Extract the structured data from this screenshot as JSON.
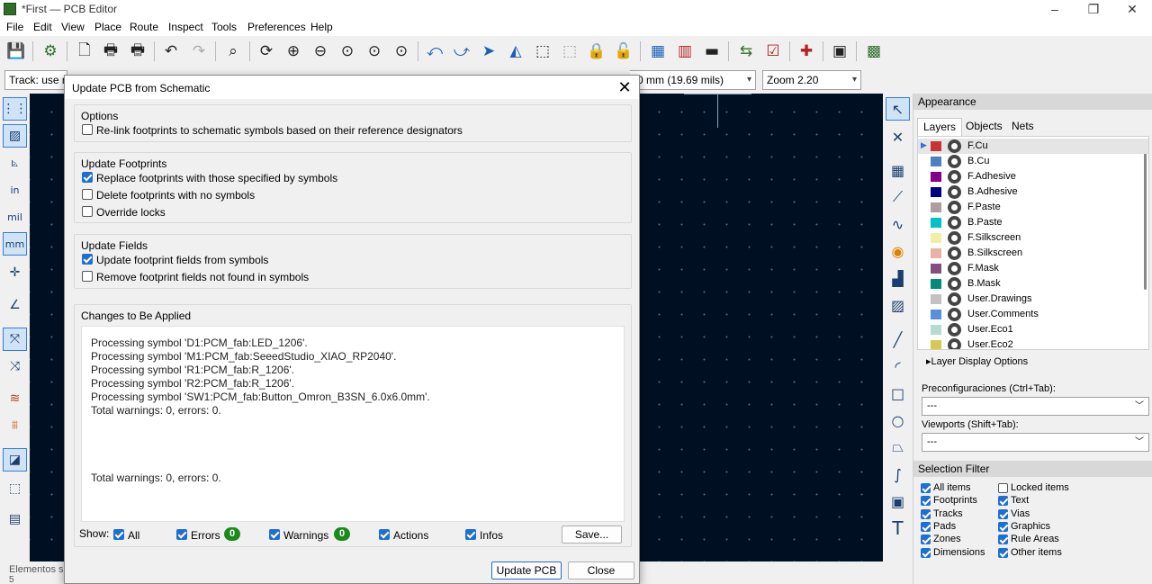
{
  "window": {
    "title": "*First — PCB Editor",
    "minimize": "–",
    "maximize": "❐",
    "close": "✕"
  },
  "menu": [
    "File",
    "Edit",
    "View",
    "Place",
    "Route",
    "Inspect",
    "Tools",
    "Preferences",
    "Help"
  ],
  "aux": {
    "track": "Track: use ne",
    "grid": "0 mm (19.69 mils)",
    "zoom": "Zoom 2.20"
  },
  "status": {
    "line1": "Elementos s",
    "line2": "5"
  },
  "appearance": {
    "header": "Appearance",
    "tabs": [
      "Layers",
      "Objects",
      "Nets"
    ],
    "layers": [
      {
        "name": "F.Cu",
        "color": "#c83434"
      },
      {
        "name": "B.Cu",
        "color": "#4d7fc4"
      },
      {
        "name": "F.Adhesive",
        "color": "#84008a"
      },
      {
        "name": "B.Adhesive",
        "color": "#000084"
      },
      {
        "name": "F.Paste",
        "color": "#b09d9d"
      },
      {
        "name": "B.Paste",
        "color": "#00c2c2"
      },
      {
        "name": "F.Silkscreen",
        "color": "#f2eda1"
      },
      {
        "name": "B.Silkscreen",
        "color": "#e8b2a7"
      },
      {
        "name": "F.Mask",
        "color": "#844c84"
      },
      {
        "name": "B.Mask",
        "color": "#028a7c"
      },
      {
        "name": "User.Drawings",
        "color": "#c2c2c2"
      },
      {
        "name": "User.Comments",
        "color": "#5990db"
      },
      {
        "name": "User.Eco1",
        "color": "#b4dbd2"
      },
      {
        "name": "User.Eco2",
        "color": "#d8c852"
      }
    ],
    "layer_display": "Layer Display Options",
    "presets_label": "Preconfiguraciones (Ctrl+Tab):",
    "presets_value": "---",
    "viewports_label": "Viewports (Shift+Tab):",
    "viewports_value": "---"
  },
  "selection_filter": {
    "header": "Selection Filter",
    "left": [
      "All items",
      "Footprints",
      "Tracks",
      "Pads",
      "Zones",
      "Dimensions"
    ],
    "right": [
      "Locked items",
      "Text",
      "Vias",
      "Graphics",
      "Rule Areas",
      "Other items"
    ],
    "locked_checked": false
  },
  "dialog": {
    "title": "Update PCB from Schematic",
    "close": "✕",
    "options_title": "Options",
    "relink": "Re-link footprints to schematic symbols based on their reference designators",
    "footprints_title": "Update Footprints",
    "replace": "Replace footprints with those specified by symbols",
    "delete": "Delete footprints with no symbols",
    "override": "Override locks",
    "fields_title": "Update Fields",
    "update_fields": "Update footprint fields from symbols",
    "remove_fields": "Remove footprint fields not found in symbols",
    "changes_title": "Changes to Be Applied",
    "log": [
      "Processing symbol 'D1:PCM_fab:LED_1206'.",
      "Processing symbol 'M1:PCM_fab:SeeedStudio_XIAO_RP2040'.",
      "Processing symbol 'R1:PCM_fab:R_1206'.",
      "Processing symbol 'R2:PCM_fab:R_1206'.",
      "Processing symbol 'SW1:PCM_fab:Button_Omron_B3SN_6.0x6.0mm'.",
      "Total warnings: 0, errors: 0."
    ],
    "log_total": "Total warnings: 0, errors: 0.",
    "show_label": "Show:",
    "filters": {
      "all": "All",
      "errors": "Errors",
      "warnings": "Warnings",
      "actions": "Actions",
      "infos": "Infos"
    },
    "errors_count": "0",
    "warnings_count": "0",
    "save": "Save...",
    "update": "Update PCB",
    "close_btn": "Close"
  }
}
